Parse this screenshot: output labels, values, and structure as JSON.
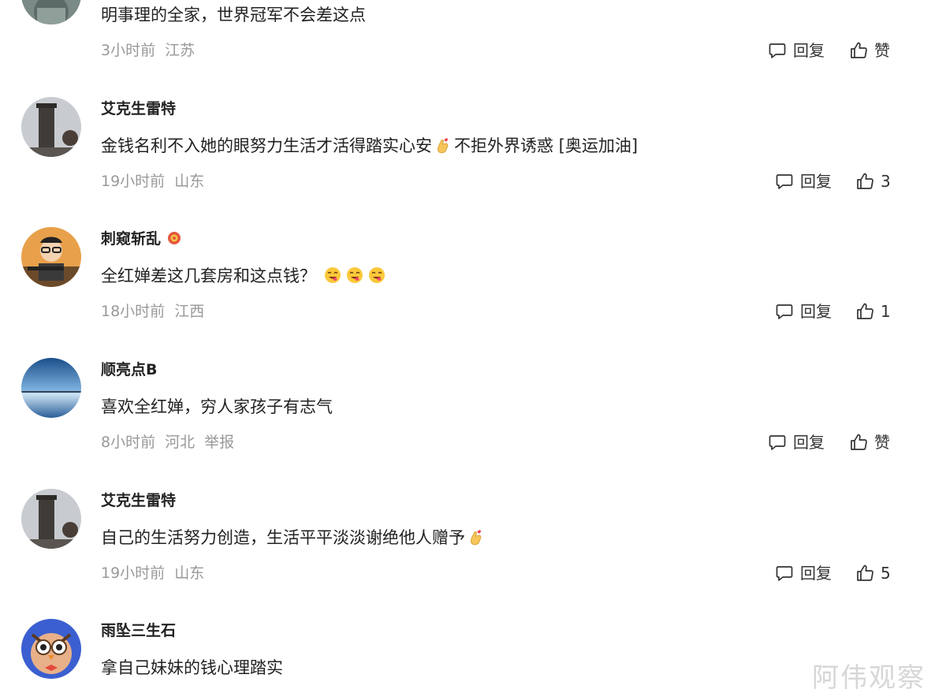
{
  "comments": [
    {
      "username": "",
      "content": "明事理的全家，世界冠军不会差这点",
      "time": "3小时前",
      "location": "江苏",
      "reply_label": "回复",
      "like_label": "赞"
    },
    {
      "username": "艾克生雷特",
      "content": "金钱名利不入她的眼努力生活才活得踏实心安",
      "content_after": "不拒外界诱惑 [奥运加油]",
      "emoji": "finger-heart-emoji",
      "time": "19小时前",
      "location": "山东",
      "reply_label": "回复",
      "like_label": "3"
    },
    {
      "username": "刺窥斩乱",
      "badge": "badge-icon",
      "content": "全红婵差这几套房和这点钱？",
      "emoji": "yummy-face-emoji",
      "time": "18小时前",
      "location": "江西",
      "reply_label": "回复",
      "like_label": "1"
    },
    {
      "username": "顺亮点B",
      "content": "喜欢全红婵，穷人家孩子有志气",
      "time": "8小时前",
      "location": "河北",
      "report_label": "举报",
      "reply_label": "回复",
      "like_label": "赞"
    },
    {
      "username": "艾克生雷特",
      "content": "自己的生活努力创造，生活平平淡淡谢绝他人赠予",
      "emoji": "finger-heart-emoji",
      "time": "19小时前",
      "location": "山东",
      "reply_label": "回复",
      "like_label": "5"
    },
    {
      "username": "雨坠三生石",
      "content": "拿自己妹妹的钱心理踏实"
    }
  ],
  "watermark": "阿伟观察",
  "icons": {
    "reply": "comment-bubble-icon",
    "like": "thumbs-up-icon"
  },
  "colors": {
    "meta_text": "#999999",
    "text": "#222222"
  }
}
